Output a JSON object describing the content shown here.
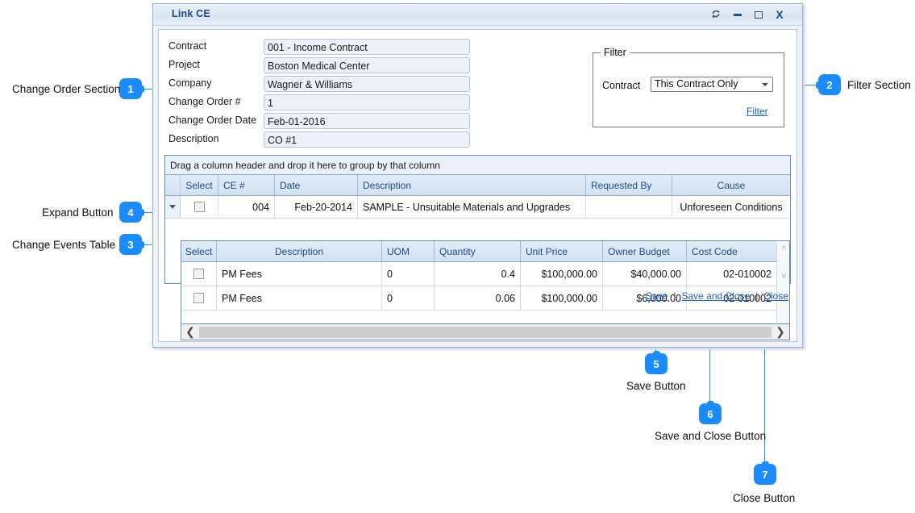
{
  "window": {
    "title": "Link CE",
    "buttons": {
      "refresh": "↻",
      "minimize": "–",
      "maximize": "□",
      "close": "X"
    }
  },
  "form": {
    "fields": [
      {
        "label": "Contract",
        "value": "001 - Income Contract"
      },
      {
        "label": "Project",
        "value": "Boston Medical Center"
      },
      {
        "label": "Company",
        "value": "Wagner & Williams"
      },
      {
        "label": "Change Order #",
        "value": "1"
      },
      {
        "label": "Change Order Date",
        "value": "Feb-01-2016"
      },
      {
        "label": "Description",
        "value": "CO #1"
      }
    ]
  },
  "filter": {
    "legend": "Filter",
    "contract_label": "Contract",
    "contract_value": "This Contract Only",
    "options": [
      "This Contract Only"
    ],
    "link": "Filter"
  },
  "grid": {
    "group_panel_text": "Drag a column header and drop it here to group by that column",
    "columns": [
      "Select",
      "CE #",
      "Date",
      "Description",
      "Requested By",
      "Cause"
    ],
    "rows": [
      {
        "select": "",
        "ce_number": "004",
        "date": "Feb-20-2014",
        "description": "SAMPLE - Unsuitable Materials and Upgrades",
        "requested_by": "",
        "cause": "Unforeseen Conditions"
      }
    ]
  },
  "detail_grid": {
    "columns": [
      "Select",
      "Description",
      "UOM",
      "Quantity",
      "Unit Price",
      "Owner Budget",
      "Cost Code"
    ],
    "rows": [
      {
        "select": "",
        "description": "PM Fees",
        "uom": "0",
        "quantity": "0.4",
        "unit_price": "$100,000.00",
        "owner_budget": "$40,000.00",
        "cost_code": "02-010002"
      },
      {
        "select": "",
        "description": "PM Fees",
        "uom": "0",
        "quantity": "0.06",
        "unit_price": "$100,000.00",
        "owner_budget": "$6,000.00",
        "cost_code": "02-010002"
      }
    ]
  },
  "footer": {
    "save": "Save",
    "separator": "|",
    "save_and_close": "Save and Close",
    "close": "Close"
  },
  "annotations": {
    "accent_color": "#1a8cff",
    "items": [
      {
        "number": "1",
        "label": "Change Order Section"
      },
      {
        "number": "2",
        "label": "Filter Section"
      },
      {
        "number": "3",
        "label": "Change Events Table"
      },
      {
        "number": "4",
        "label": "Expand Button"
      },
      {
        "number": "5",
        "label": "Save Button"
      },
      {
        "number": "6",
        "label": "Save and Close Button"
      },
      {
        "number": "7",
        "label": "Close Button"
      }
    ]
  }
}
